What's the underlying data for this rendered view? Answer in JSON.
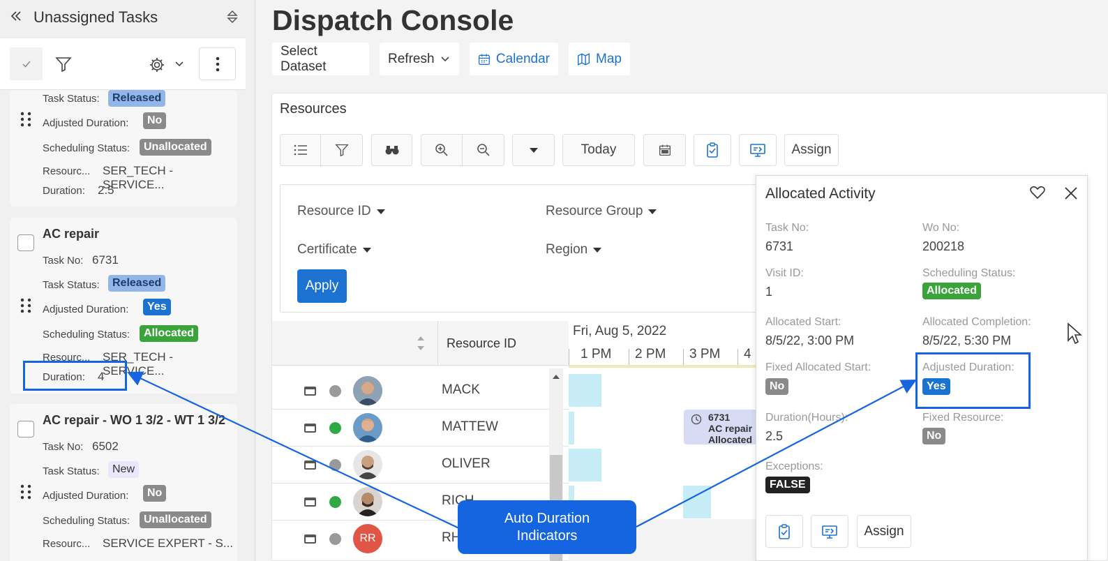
{
  "left_panel": {
    "title": "Unassigned Tasks",
    "cards": [
      {
        "title": "",
        "task_status_label": "Task Status:",
        "task_status": "Released",
        "adjusted_duration_label": "Adjusted Duration:",
        "adjusted_duration": "No",
        "scheduling_status_label": "Scheduling Status:",
        "scheduling_status": "Unallocated",
        "resource_label": "Resourc...",
        "resource": "SER_TECH - SERVICE...",
        "duration_label": "Duration:",
        "duration": "2.5"
      },
      {
        "title": "AC repair",
        "task_no_label": "Task No:",
        "task_no": "6731",
        "task_status_label": "Task Status:",
        "task_status": "Released",
        "adjusted_duration_label": "Adjusted Duration:",
        "adjusted_duration": "Yes",
        "scheduling_status_label": "Scheduling Status:",
        "scheduling_status": "Allocated",
        "resource_label": "Resourc...",
        "resource": "SER_TECH - SERVICE...",
        "duration_label": "Duration:",
        "duration": "4"
      },
      {
        "title": "AC repair - WO 1 3/2 - WT 1 3/2",
        "task_no_label": "Task No:",
        "task_no": "6502",
        "task_status_label": "Task Status:",
        "task_status": "New",
        "adjusted_duration_label": "Adjusted Duration:",
        "adjusted_duration": "No",
        "scheduling_status_label": "Scheduling Status:",
        "scheduling_status": "Unallocated",
        "resource_label": "Resourc...",
        "resource": "SERVICE EXPERT - S..."
      }
    ]
  },
  "main": {
    "title": "Dispatch Console",
    "toolbar": {
      "select_dataset": "Select Dataset",
      "refresh": "Refresh",
      "calendar": "Calendar",
      "map": "Map"
    },
    "resources": {
      "heading": "Resources",
      "today": "Today",
      "assign": "Assign",
      "filters": {
        "resource_id": "Resource ID",
        "resource_group": "Resource Group",
        "certificate": "Certificate",
        "region": "Region",
        "apply": "Apply"
      },
      "grid": {
        "column": "Resource ID",
        "date": "Fri, Aug 5, 2022",
        "ticks": [
          "1 PM",
          "2 PM",
          "3 PM",
          "4"
        ],
        "rows": [
          {
            "name": "MACK",
            "status_color": "#9a9a9a"
          },
          {
            "name": "MATTEW",
            "status_color": "#2eaa44"
          },
          {
            "name": "OLIVER",
            "status_color": "#9a9a9a"
          },
          {
            "name": "RICH",
            "status_color": "#2eaa44"
          },
          {
            "name": "RH",
            "status_color": "#9a9a9a",
            "initials": "RR"
          }
        ],
        "event": {
          "task_no": "6731",
          "title": "AC repair",
          "status": "Allocated"
        }
      }
    }
  },
  "popup": {
    "title": "Allocated Activity",
    "task_no_label": "Task No:",
    "task_no": "6731",
    "wo_no_label": "Wo No:",
    "wo_no": "200218",
    "visit_id_label": "Visit ID:",
    "visit_id": "1",
    "scheduling_status_label": "Scheduling Status:",
    "scheduling_status": "Allocated",
    "allocated_start_label": "Allocated Start:",
    "allocated_start": "8/5/22, 3:00 PM",
    "allocated_completion_label": "Allocated Completion:",
    "allocated_completion": "8/5/22, 5:30 PM",
    "fixed_allocated_start_label": "Fixed Allocated Start:",
    "fixed_allocated_start": "No",
    "adjusted_duration_label": "Adjusted Duration:",
    "adjusted_duration": "Yes",
    "duration_label": "Duration(Hours):",
    "duration": "2.5",
    "fixed_resource_label": "Fixed Resource:",
    "fixed_resource": "No",
    "exceptions_label": "Exceptions:",
    "exceptions": "FALSE",
    "assign": "Assign"
  },
  "callout": {
    "line1": "Auto Duration",
    "line2": "Indicators"
  },
  "colors": {
    "accent": "#1b72d0",
    "callout": "#1565e0",
    "allocated": "#3aa43a"
  }
}
